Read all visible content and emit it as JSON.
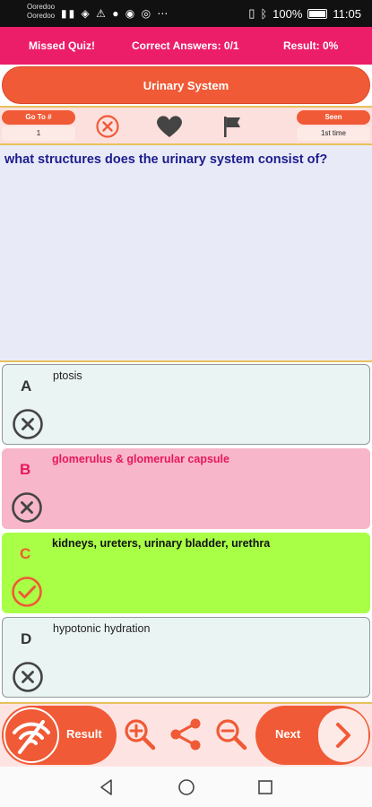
{
  "status_bar": {
    "carrier_line1": "Ooredoo",
    "carrier_line2": "Ooredoo",
    "battery": "100%",
    "time": "11:05"
  },
  "header": {
    "missed": "Missed Quiz!",
    "correct": "Correct Answers: 0/1",
    "result": "Result: 0%"
  },
  "topic": "Urinary System",
  "toolbar": {
    "goto_label": "Go To #",
    "goto_value": "1",
    "seen_label": "Seen",
    "seen_value": "1st time",
    "icons": [
      "close-circle-icon",
      "heart-icon",
      "flag-icon"
    ]
  },
  "question": "what structures does the urinary system consist of?",
  "answers": [
    {
      "letter": "A",
      "text": "ptosis",
      "state": "wrong",
      "icon": "x-circle-icon"
    },
    {
      "letter": "B",
      "text": "glomerulus & glomerular capsule",
      "state": "selected-wrong",
      "icon": "x-circle-icon"
    },
    {
      "letter": "C",
      "text": "kidneys, ureters, urinary bladder, urethra",
      "state": "correct",
      "icon": "check-circle-icon"
    },
    {
      "letter": "D",
      "text": "hypotonic hydration",
      "state": "wrong",
      "icon": "x-circle-icon"
    }
  ],
  "actions": {
    "result_label": "Result",
    "next_label": "Next",
    "icons": [
      "zoom-in-icon",
      "share-icon",
      "zoom-out-icon"
    ]
  },
  "colors": {
    "header": "#ec1e6a",
    "accent": "#f05a36",
    "question_text": "#1d1d8c",
    "correct_bg": "#a8ff45",
    "selected_wrong_bg": "#f7b6c9"
  }
}
